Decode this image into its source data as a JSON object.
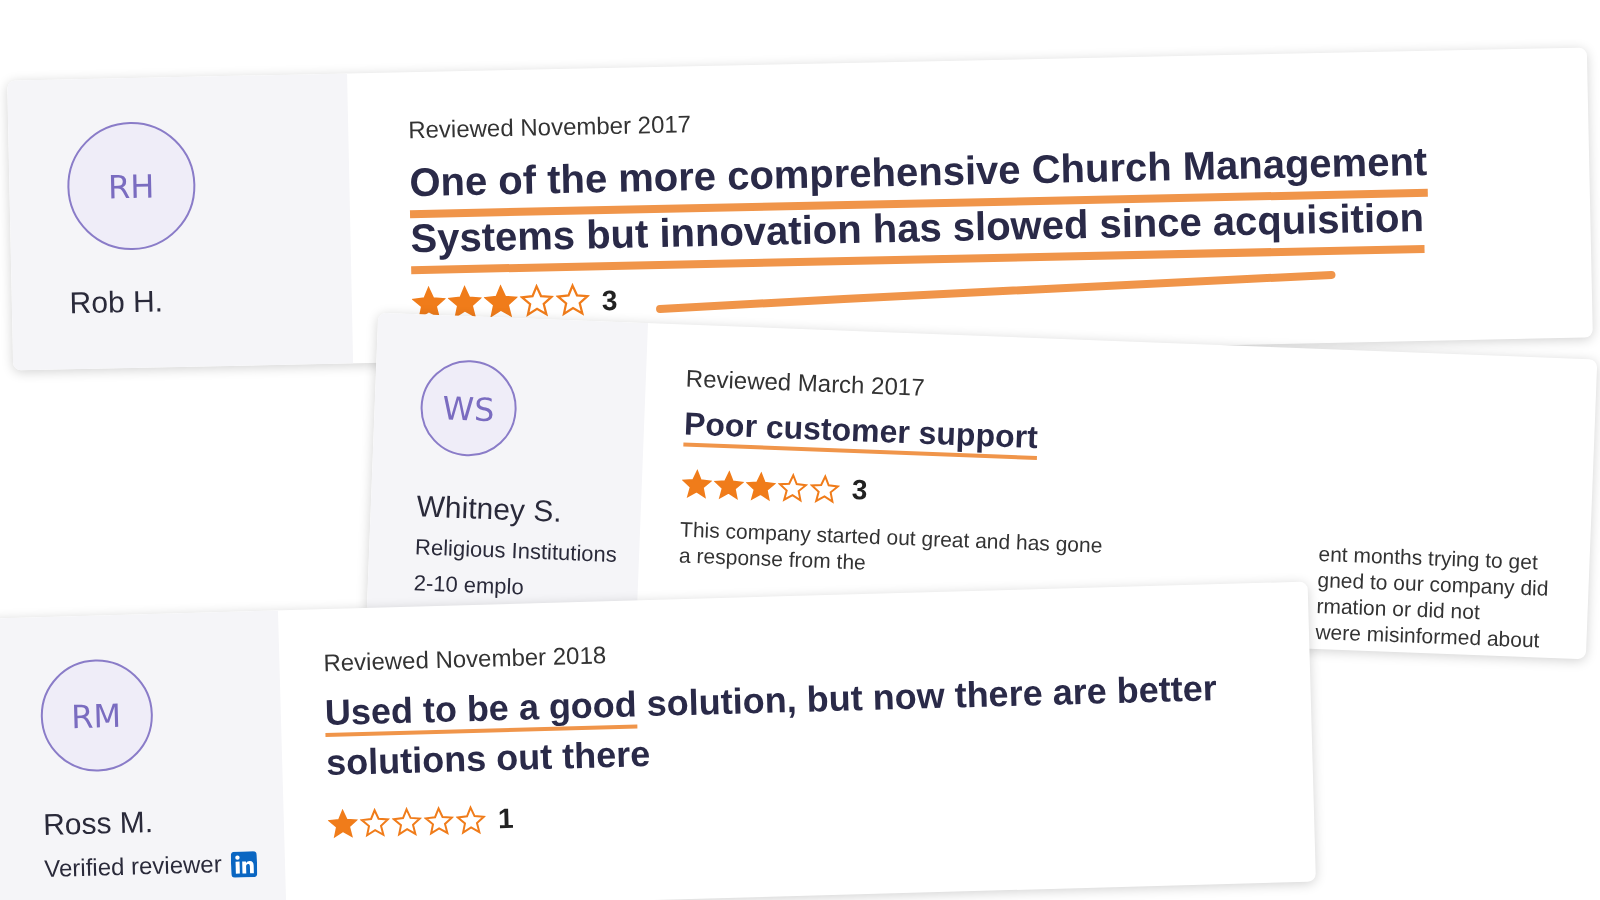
{
  "reviews": [
    {
      "initials": "RH",
      "name": "Rob H.",
      "date": "Reviewed November 2017",
      "title_parts": [
        {
          "text": "One of the more comprehensive Church Management Systems but innovation has slowed since acquisition",
          "highlighted": true
        }
      ],
      "stars": 3,
      "rating": "3"
    },
    {
      "initials": "WS",
      "name": "Whitney S.",
      "meta": [
        "Religious Institutions",
        "2-10 emplo"
      ],
      "date": "Reviewed March 2017",
      "title_parts": [
        {
          "text": "Poor customer support",
          "highlighted": true
        }
      ],
      "stars": 3,
      "rating": "3",
      "body_left": [
        "This company started out great and has gone",
        "a response from the"
      ],
      "body_right": [
        "ent months trying to get",
        "gned to our company did",
        "rmation or did not",
        "were misinformed about"
      ]
    },
    {
      "initials": "RM",
      "name": "Ross M.",
      "date": "Reviewed November 2018",
      "title_parts": [
        {
          "text": "Used to be a good",
          "highlighted": true
        },
        {
          "text": " solution, but now there are better solutions out there",
          "highlighted": false
        }
      ],
      "stars": 1,
      "rating": "1",
      "verified": "Verified reviewer"
    }
  ]
}
